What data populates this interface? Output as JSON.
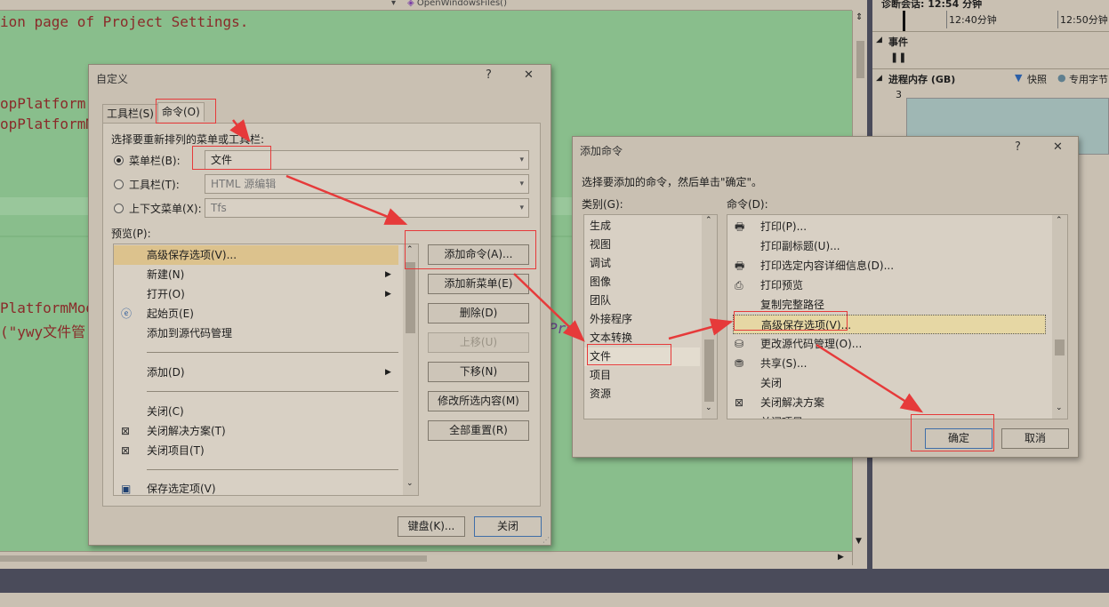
{
  "editor": {
    "nav_left": "",
    "nav_right": "OpenWindowsFiles()",
    "lines": [
      "ion page of Project Settings.",
      "opPlatform",
      "opPlatformM",
      "PlatformMod",
      "(\"ywy文件管"
    ],
    "peek_text": "Pro"
  },
  "diagnostics": {
    "session": "诊断会话: 12:54 分钟",
    "tick1": "12:40分钟",
    "tick2": "12:50分钟",
    "events": "事件",
    "memory": "进程内存 (GB)",
    "snapshot": "快照",
    "private": "专用字节",
    "y_value": "3"
  },
  "customize": {
    "title": "自定义",
    "help": "?",
    "close": "✕",
    "tabs": [
      "工具栏(S)",
      "命令(O)"
    ],
    "choose_label": "选择要重新排列的菜单或工具栏:",
    "menubar_label": "菜单栏(B):",
    "menubar_value": "文件",
    "toolbar_label": "工具栏(T):",
    "toolbar_value": "HTML 源编辑",
    "context_label": "上下文菜单(X):",
    "context_value": "Tfs",
    "preview_label": "预览(P):",
    "preview_items": [
      {
        "label": "高级保存选项(V)...",
        "sub": false,
        "icon": ""
      },
      {
        "label": "新建(N)",
        "sub": true,
        "icon": ""
      },
      {
        "label": "打开(O)",
        "sub": true,
        "icon": ""
      },
      {
        "label": "起始页(E)",
        "sub": false,
        "icon": "start-page-icon"
      },
      {
        "label": "添加到源代码管理",
        "sub": false,
        "icon": ""
      },
      {
        "label": "添加(D)",
        "sub": true,
        "icon": ""
      },
      {
        "label": "关闭(C)",
        "sub": false,
        "icon": ""
      },
      {
        "label": "关闭解决方案(T)",
        "sub": false,
        "icon": "close-solution-icon"
      },
      {
        "label": "关闭项目(T)",
        "sub": false,
        "icon": "close-project-icon"
      },
      {
        "label": "保存选定项(V)",
        "sub": false,
        "icon": "save-icon"
      }
    ],
    "buttons": {
      "add_command": "添加命令(A)...",
      "add_menu": "添加新菜单(E)",
      "delete": "删除(D)",
      "move_up": "上移(U)",
      "move_down": "下移(N)",
      "modify": "修改所选内容(M)",
      "reset_all": "全部重置(R)"
    },
    "keyboard": "键盘(K)...",
    "close_btn": "关闭"
  },
  "add_command": {
    "title": "添加命令",
    "help": "?",
    "close": "✕",
    "instruction": "选择要添加的命令，然后单击\"确定\"。",
    "categories_label": "类别(G):",
    "commands_label": "命令(D):",
    "categories": [
      "生成",
      "视图",
      "调试",
      "图像",
      "团队",
      "外接程序",
      "文本转换",
      "文件",
      "项目",
      "资源"
    ],
    "commands": [
      {
        "label": "打印(P)...",
        "icon": "print-icon"
      },
      {
        "label": "打印副标题(U)...",
        "icon": ""
      },
      {
        "label": "打印选定内容详细信息(D)...",
        "icon": "print-details-icon"
      },
      {
        "label": "打印预览",
        "icon": "print-preview-icon"
      },
      {
        "label": "复制完整路径",
        "icon": ""
      },
      {
        "label": "高级保存选项(V)...",
        "icon": ""
      },
      {
        "label": "更改源代码管理(O)...",
        "icon": "source-control-icon"
      },
      {
        "label": "共享(S)...",
        "icon": "share-icon"
      },
      {
        "label": "关闭",
        "icon": ""
      },
      {
        "label": "关闭解决方案",
        "icon": "close-solution-icon"
      },
      {
        "label": "关闭项目",
        "icon": ""
      }
    ],
    "ok": "确定",
    "cancel": "取消"
  },
  "annotation_color": "#e63a3a"
}
